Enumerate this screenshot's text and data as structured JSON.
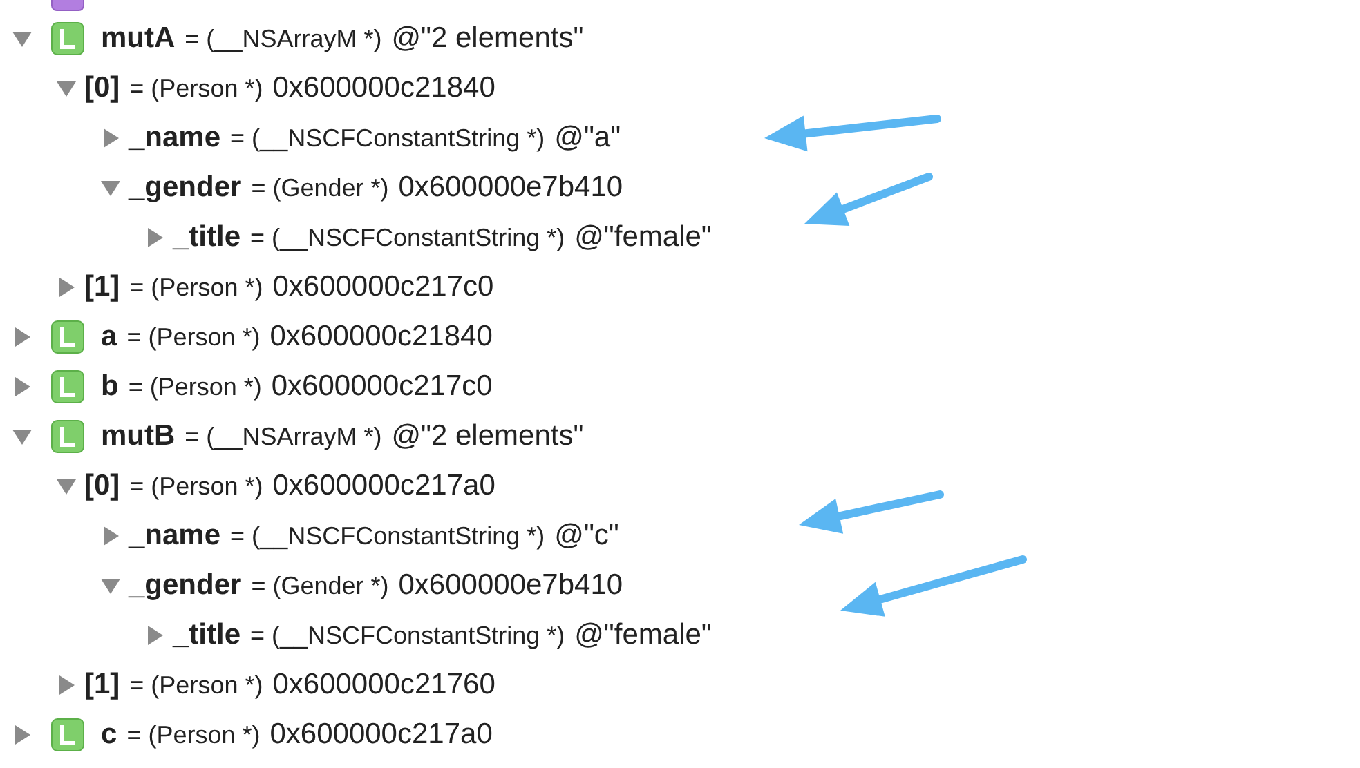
{
  "variables": [
    {
      "name": "mutA",
      "type": "= (__NSArrayM *)",
      "value": "@\"2 elements\"",
      "local": true,
      "expanded": true,
      "children": [
        {
          "name": "[0]",
          "type": "= (Person *)",
          "value": "0x600000c21840",
          "local": false,
          "expanded": true,
          "children": [
            {
              "name": "_name",
              "type": "= (__NSCFConstantString *)",
              "value": "@\"a\"",
              "local": false,
              "expanded": false
            },
            {
              "name": "_gender",
              "type": "= (Gender *)",
              "value": "0x600000e7b410",
              "local": false,
              "expanded": true,
              "children": [
                {
                  "name": "_title",
                  "type": "= (__NSCFConstantString *)",
                  "value": "@\"female\"",
                  "local": false,
                  "expanded": false
                }
              ]
            }
          ]
        },
        {
          "name": "[1]",
          "type": "= (Person *)",
          "value": "0x600000c217c0",
          "local": false,
          "expanded": false
        }
      ]
    },
    {
      "name": "a",
      "type": "= (Person *)",
      "value": "0x600000c21840",
      "local": true,
      "expanded": false
    },
    {
      "name": "b",
      "type": "= (Person *)",
      "value": "0x600000c217c0",
      "local": true,
      "expanded": false
    },
    {
      "name": "mutB",
      "type": "= (__NSArrayM *)",
      "value": "@\"2 elements\"",
      "local": true,
      "expanded": true,
      "children": [
        {
          "name": "[0]",
          "type": "= (Person *)",
          "value": "0x600000c217a0",
          "local": false,
          "expanded": true,
          "children": [
            {
              "name": "_name",
              "type": "= (__NSCFConstantString *)",
              "value": "@\"c\"",
              "local": false,
              "expanded": false
            },
            {
              "name": "_gender",
              "type": "= (Gender *)",
              "value": "0x600000e7b410",
              "local": false,
              "expanded": true,
              "children": [
                {
                  "name": "_title",
                  "type": "= (__NSCFConstantString *)",
                  "value": "@\"female\"",
                  "local": false,
                  "expanded": false
                }
              ]
            }
          ]
        },
        {
          "name": "[1]",
          "type": "= (Person *)",
          "value": "0x600000c21760",
          "local": false,
          "expanded": false
        }
      ]
    },
    {
      "name": "c",
      "type": "= (Person *)",
      "value": "0x600000c217a0",
      "local": true,
      "expanded": false
    }
  ]
}
